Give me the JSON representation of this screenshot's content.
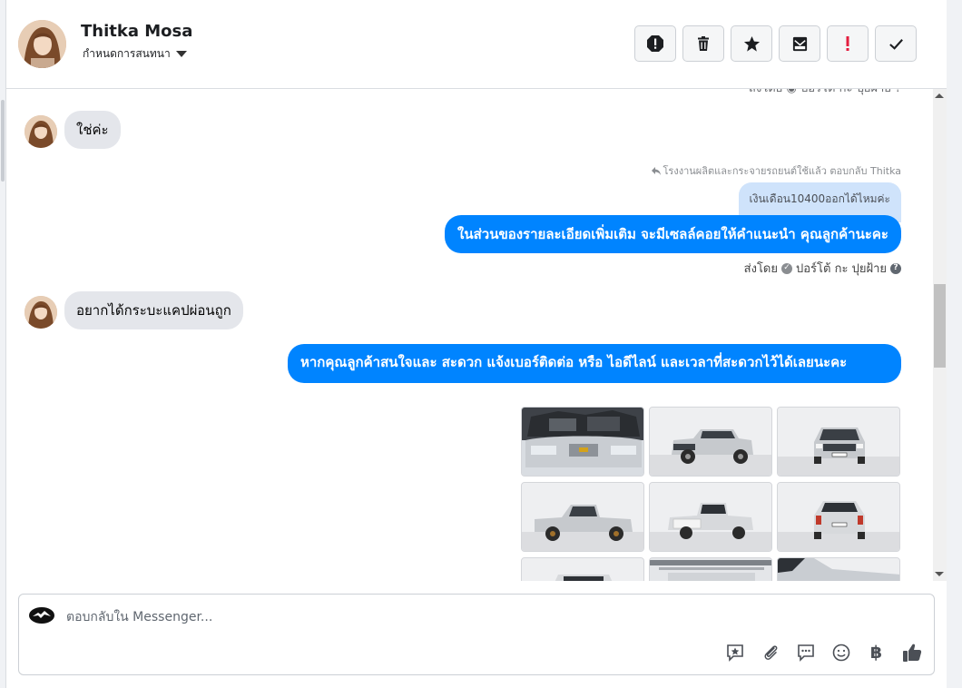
{
  "header": {
    "contact_name": "Thitka Mosa",
    "assign_label": "กำหนดการสนทนา",
    "actions": [
      "warning-icon",
      "trash-icon",
      "star-icon",
      "archive-icon",
      "exclamation-icon",
      "check-icon"
    ]
  },
  "conversation": {
    "clipped_line": "ส่งโดย ◉ ปอร์โต้ กะ ปุยฝ้าย ?",
    "messages": {
      "m1": "ใช่ค่ะ",
      "reply_label": "โรงงานผลิตและกระจายรถยนต์ใช้แล้ว ตอบกลับ Thitka",
      "quoted": "เงินเดือน10400ออกได้ไหมค่ะ",
      "m2": "ในส่วนของรายละเอียดเพิ่มเติม จะมีเซลล์คอยให้คำแนะนำ คุณลูกค้านะคะ",
      "sent_by_prefix": "ส่งโดย",
      "sent_by_name": "ปอร์โต้ กะ ปุยฝ้าย",
      "m3": "อยากได้กระบะแคปผ่อนถูก",
      "m4": "หากคุณลูกค้าสนใจและ สะดวก แจ้งเบอร์ติดต่อ หรือ ไอดีไลน์ และเวลาที่สะดวกไว้ได้เลยนะคะ"
    },
    "photos": [
      "engine",
      "front-left",
      "front",
      "side-left",
      "rear-left",
      "rear",
      "interior",
      "roof",
      "hood"
    ]
  },
  "composer": {
    "placeholder": "ตอบกลับใน Messenger...",
    "baht_symbol": "฿"
  }
}
